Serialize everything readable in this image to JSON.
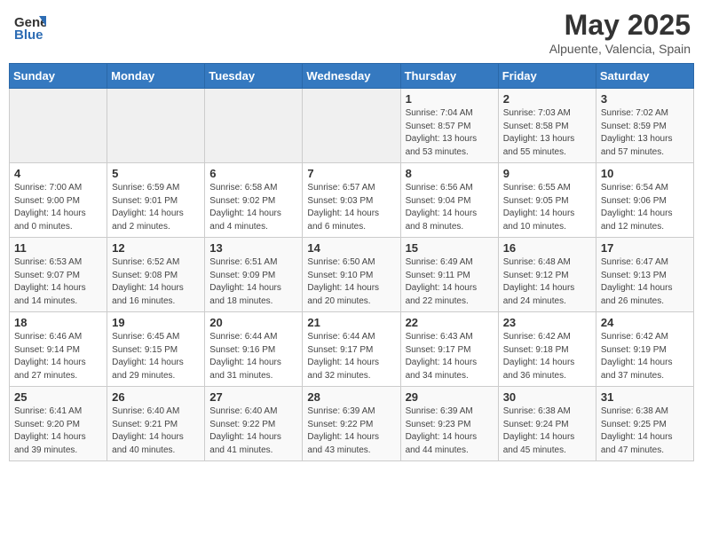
{
  "header": {
    "logo_general": "General",
    "logo_blue": "Blue",
    "month": "May 2025",
    "location": "Alpuente, Valencia, Spain"
  },
  "days_of_week": [
    "Sunday",
    "Monday",
    "Tuesday",
    "Wednesday",
    "Thursday",
    "Friday",
    "Saturday"
  ],
  "weeks": [
    [
      {
        "day": "",
        "info": ""
      },
      {
        "day": "",
        "info": ""
      },
      {
        "day": "",
        "info": ""
      },
      {
        "day": "",
        "info": ""
      },
      {
        "day": "1",
        "info": "Sunrise: 7:04 AM\nSunset: 8:57 PM\nDaylight: 13 hours\nand 53 minutes."
      },
      {
        "day": "2",
        "info": "Sunrise: 7:03 AM\nSunset: 8:58 PM\nDaylight: 13 hours\nand 55 minutes."
      },
      {
        "day": "3",
        "info": "Sunrise: 7:02 AM\nSunset: 8:59 PM\nDaylight: 13 hours\nand 57 minutes."
      }
    ],
    [
      {
        "day": "4",
        "info": "Sunrise: 7:00 AM\nSunset: 9:00 PM\nDaylight: 14 hours\nand 0 minutes."
      },
      {
        "day": "5",
        "info": "Sunrise: 6:59 AM\nSunset: 9:01 PM\nDaylight: 14 hours\nand 2 minutes."
      },
      {
        "day": "6",
        "info": "Sunrise: 6:58 AM\nSunset: 9:02 PM\nDaylight: 14 hours\nand 4 minutes."
      },
      {
        "day": "7",
        "info": "Sunrise: 6:57 AM\nSunset: 9:03 PM\nDaylight: 14 hours\nand 6 minutes."
      },
      {
        "day": "8",
        "info": "Sunrise: 6:56 AM\nSunset: 9:04 PM\nDaylight: 14 hours\nand 8 minutes."
      },
      {
        "day": "9",
        "info": "Sunrise: 6:55 AM\nSunset: 9:05 PM\nDaylight: 14 hours\nand 10 minutes."
      },
      {
        "day": "10",
        "info": "Sunrise: 6:54 AM\nSunset: 9:06 PM\nDaylight: 14 hours\nand 12 minutes."
      }
    ],
    [
      {
        "day": "11",
        "info": "Sunrise: 6:53 AM\nSunset: 9:07 PM\nDaylight: 14 hours\nand 14 minutes."
      },
      {
        "day": "12",
        "info": "Sunrise: 6:52 AM\nSunset: 9:08 PM\nDaylight: 14 hours\nand 16 minutes."
      },
      {
        "day": "13",
        "info": "Sunrise: 6:51 AM\nSunset: 9:09 PM\nDaylight: 14 hours\nand 18 minutes."
      },
      {
        "day": "14",
        "info": "Sunrise: 6:50 AM\nSunset: 9:10 PM\nDaylight: 14 hours\nand 20 minutes."
      },
      {
        "day": "15",
        "info": "Sunrise: 6:49 AM\nSunset: 9:11 PM\nDaylight: 14 hours\nand 22 minutes."
      },
      {
        "day": "16",
        "info": "Sunrise: 6:48 AM\nSunset: 9:12 PM\nDaylight: 14 hours\nand 24 minutes."
      },
      {
        "day": "17",
        "info": "Sunrise: 6:47 AM\nSunset: 9:13 PM\nDaylight: 14 hours\nand 26 minutes."
      }
    ],
    [
      {
        "day": "18",
        "info": "Sunrise: 6:46 AM\nSunset: 9:14 PM\nDaylight: 14 hours\nand 27 minutes."
      },
      {
        "day": "19",
        "info": "Sunrise: 6:45 AM\nSunset: 9:15 PM\nDaylight: 14 hours\nand 29 minutes."
      },
      {
        "day": "20",
        "info": "Sunrise: 6:44 AM\nSunset: 9:16 PM\nDaylight: 14 hours\nand 31 minutes."
      },
      {
        "day": "21",
        "info": "Sunrise: 6:44 AM\nSunset: 9:17 PM\nDaylight: 14 hours\nand 32 minutes."
      },
      {
        "day": "22",
        "info": "Sunrise: 6:43 AM\nSunset: 9:17 PM\nDaylight: 14 hours\nand 34 minutes."
      },
      {
        "day": "23",
        "info": "Sunrise: 6:42 AM\nSunset: 9:18 PM\nDaylight: 14 hours\nand 36 minutes."
      },
      {
        "day": "24",
        "info": "Sunrise: 6:42 AM\nSunset: 9:19 PM\nDaylight: 14 hours\nand 37 minutes."
      }
    ],
    [
      {
        "day": "25",
        "info": "Sunrise: 6:41 AM\nSunset: 9:20 PM\nDaylight: 14 hours\nand 39 minutes."
      },
      {
        "day": "26",
        "info": "Sunrise: 6:40 AM\nSunset: 9:21 PM\nDaylight: 14 hours\nand 40 minutes."
      },
      {
        "day": "27",
        "info": "Sunrise: 6:40 AM\nSunset: 9:22 PM\nDaylight: 14 hours\nand 41 minutes."
      },
      {
        "day": "28",
        "info": "Sunrise: 6:39 AM\nSunset: 9:22 PM\nDaylight: 14 hours\nand 43 minutes."
      },
      {
        "day": "29",
        "info": "Sunrise: 6:39 AM\nSunset: 9:23 PM\nDaylight: 14 hours\nand 44 minutes."
      },
      {
        "day": "30",
        "info": "Sunrise: 6:38 AM\nSunset: 9:24 PM\nDaylight: 14 hours\nand 45 minutes."
      },
      {
        "day": "31",
        "info": "Sunrise: 6:38 AM\nSunset: 9:25 PM\nDaylight: 14 hours\nand 47 minutes."
      }
    ]
  ]
}
